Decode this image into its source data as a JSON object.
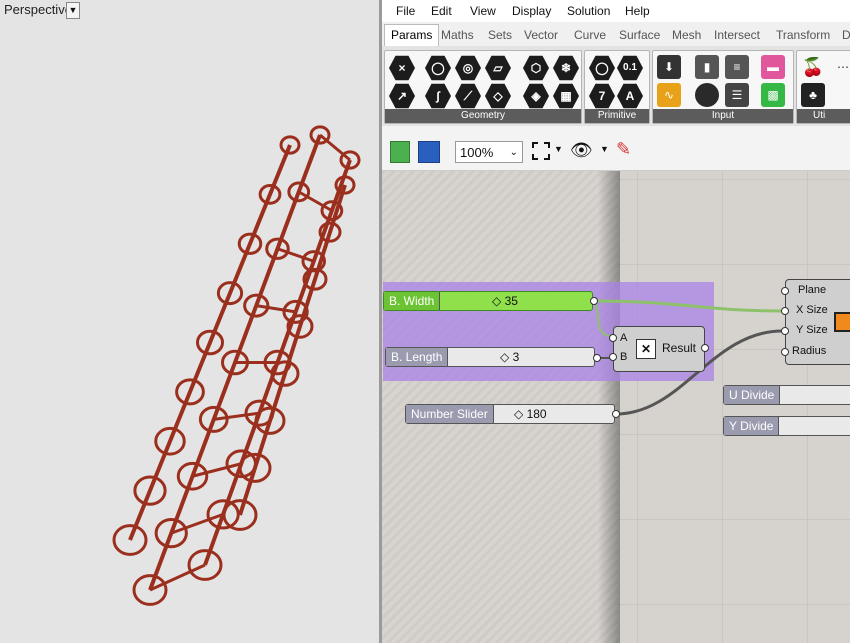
{
  "viewport": {
    "title": "Perspective",
    "dropdown_icon": "triangle-down-icon"
  },
  "menu": {
    "items": [
      "File",
      "Edit",
      "View",
      "Display",
      "Solution",
      "Help"
    ]
  },
  "tabs": {
    "items": [
      "Params",
      "Maths",
      "Sets",
      "Vector",
      "Curve",
      "Surface",
      "Mesh",
      "Intersect",
      "Transform",
      "D"
    ],
    "active": "Params"
  },
  "ribbon": {
    "groups": [
      "Geometry",
      "Primitive",
      "Input",
      "Uti"
    ],
    "primitive_glyphs": [
      "0.1",
      "7",
      "A"
    ]
  },
  "toolbar": {
    "zoom": "100%"
  },
  "canvas": {
    "sliders": {
      "width": {
        "label": "B. Width",
        "value": "35"
      },
      "length": {
        "label": "B. Length",
        "value": "3"
      },
      "number": {
        "label": "Number Slider",
        "value": "180"
      }
    },
    "multiply": {
      "inputs": [
        "A",
        "B"
      ],
      "output": "Result",
      "icon": "multiply-icon"
    },
    "rectangle": {
      "inputs": [
        "Plane",
        "X Size",
        "Y Size",
        "Radius"
      ]
    },
    "u_divide": {
      "label": "U Divide"
    },
    "y_divide": {
      "label": "Y Divide"
    }
  },
  "colors": {
    "chain": "#9b2f1e",
    "wire_green": "#8ec26a",
    "group": "#b48ce6",
    "slider_active": "#7ed13a"
  }
}
